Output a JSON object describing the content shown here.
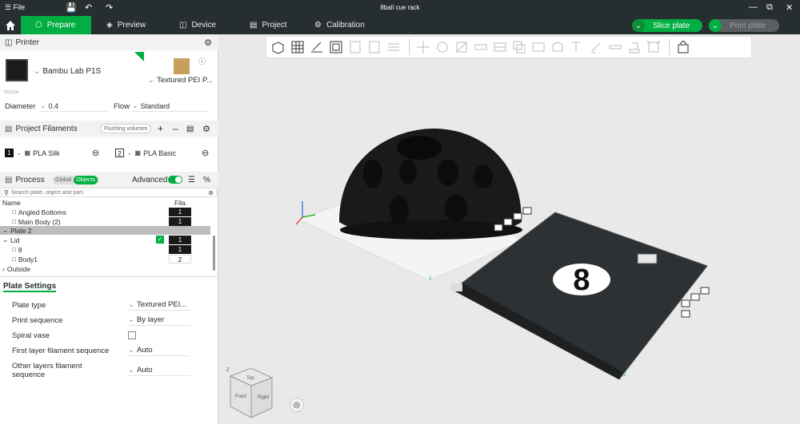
{
  "titlebar": {
    "menu_label": "File",
    "window_title": "8ball cue rack"
  },
  "tabs": [
    {
      "label": "Prepare"
    },
    {
      "label": "Preview"
    },
    {
      "label": "Device"
    },
    {
      "label": "Project"
    },
    {
      "label": "Calibration"
    }
  ],
  "actions": {
    "slice_label": "Slice plate",
    "print_label": "Print plate"
  },
  "printer": {
    "section_title": "Printer",
    "name": "Bambu Lab P1S",
    "plate_type": "Textured PEI P...",
    "nozzle_label": "Nozzle",
    "diameter_label": "Diameter",
    "diameter_value": "0.4",
    "flow_label": "Flow",
    "flow_value": "Standard"
  },
  "filaments": {
    "section_title": "Project Filaments",
    "flushing_label": "Flushing volumes",
    "items": [
      {
        "num": "1",
        "name": "PLA Silk",
        "color": "#111111"
      },
      {
        "num": "2",
        "name": "PLA Basic",
        "color": "#ffffff"
      }
    ]
  },
  "process": {
    "section_title": "Process",
    "global_label": "Global",
    "objects_label": "Objects",
    "advanced_label": "Advanced",
    "search_placeholder": "Search plate, object and part.",
    "col_name": "Name",
    "col_fila": "Fila.",
    "rows": [
      {
        "name": "Angled Bottoms",
        "fila": "1"
      },
      {
        "name": "Main Body (2)",
        "fila": "1"
      },
      {
        "name": "Plate 2",
        "fila": ""
      },
      {
        "name": "Lid",
        "fila": "1"
      },
      {
        "name": "8",
        "fila": "1"
      },
      {
        "name": "Body1",
        "fila": "2"
      },
      {
        "name": "Outside",
        "fila": ""
      }
    ]
  },
  "plate_settings": {
    "title": "Plate Settings",
    "rows": [
      {
        "label": "Plate type",
        "value": "Textured PEI..."
      },
      {
        "label": "Print sequence",
        "value": "By layer"
      },
      {
        "label": "Spiral vase",
        "value": ""
      },
      {
        "label": "First layer filament sequence",
        "value": "Auto"
      },
      {
        "label": "Other layers filament sequence",
        "value": "Auto"
      }
    ]
  },
  "viewcube": {
    "top": "Top",
    "front": "Front",
    "right": "Right",
    "axis_z": "Z"
  },
  "scene": {
    "plate_number": "8",
    "plate_label_1": "1",
    "plate_label_2": "2"
  },
  "colors": {
    "accent": "#00ae42",
    "dark": "#262e30"
  }
}
